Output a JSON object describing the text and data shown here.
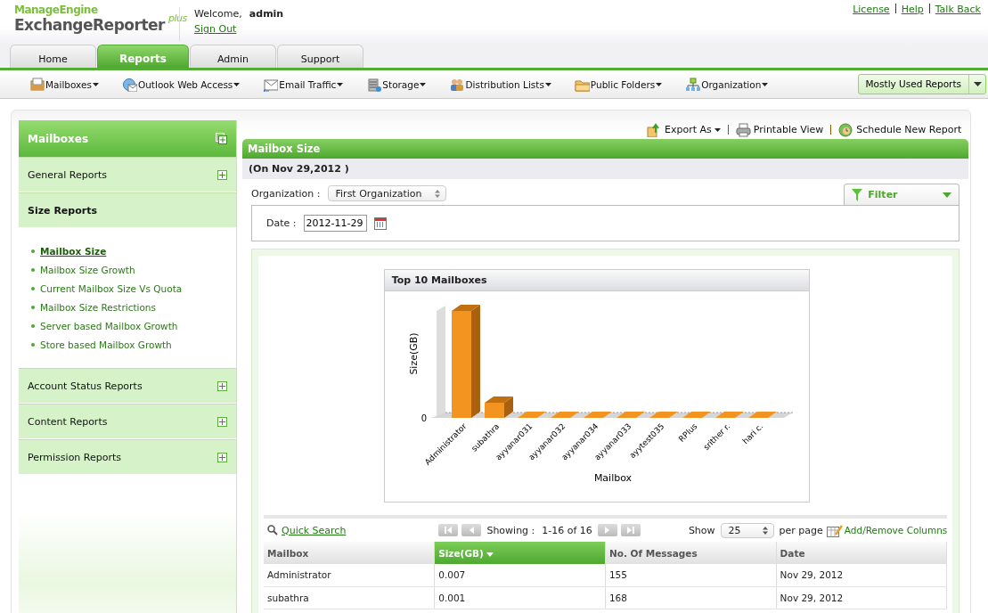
{
  "header": {
    "logo_top": "ManageEngine",
    "logo_main": "ExchangeReporter",
    "logo_suffix": "plus",
    "welcome": "Welcome,",
    "user": "admin",
    "sign_out": "Sign Out",
    "links": [
      "License",
      "Help",
      "Talk Back"
    ]
  },
  "tabs": [
    {
      "label": "Home",
      "selected": false
    },
    {
      "label": "Reports",
      "selected": true
    },
    {
      "label": "Admin",
      "selected": false
    },
    {
      "label": "Support",
      "selected": false
    }
  ],
  "menu": [
    {
      "label": "Mailboxes"
    },
    {
      "label": "Outlook Web Access"
    },
    {
      "label": "Email Traffic"
    },
    {
      "label": "Storage"
    },
    {
      "label": "Distribution Lists"
    },
    {
      "label": "Public Folders"
    },
    {
      "label": "Organization"
    }
  ],
  "quick_reports": {
    "label": "Mostly Used Reports"
  },
  "sidebar": {
    "title": "Mailboxes",
    "groups": [
      {
        "label": "General Reports",
        "expanded": false
      },
      {
        "label": "Size Reports",
        "expanded": true,
        "items": [
          {
            "label": "Mailbox Size",
            "selected": true
          },
          {
            "label": "Mailbox Size Growth",
            "selected": false
          },
          {
            "label": "Current Mailbox Size Vs Quota",
            "selected": false
          },
          {
            "label": "Mailbox Size Restrictions",
            "selected": false
          },
          {
            "label": "Server based Mailbox Growth",
            "selected": false
          },
          {
            "label": "Store based Mailbox Growth",
            "selected": false
          }
        ]
      },
      {
        "label": "Account Status Reports",
        "expanded": false
      },
      {
        "label": "Content Reports",
        "expanded": false
      },
      {
        "label": "Permission Reports",
        "expanded": false
      }
    ]
  },
  "actions": [
    {
      "label": "Export As",
      "caret": true
    },
    {
      "label": "Printable View",
      "caret": false
    },
    {
      "label": "Schedule New Report",
      "caret": false
    }
  ],
  "report": {
    "title": "Mailbox Size",
    "subtitle": "(On Nov 29,2012 )",
    "organization_label": "Organization :",
    "organization": "First Organization",
    "filter": "Filter",
    "date_label": "Date :",
    "date": "2012-11-29"
  },
  "chart": {
    "title": "Top 10 Mailboxes",
    "ylabel": "Size(GB)",
    "xlabel": "Mailbox",
    "ytick": "0",
    "categories": [
      "Administrator",
      "subathra",
      "ayyanar031",
      "ayyanar032",
      "ayyanar034",
      "ayyanar033",
      "ayytest035",
      "RPlus",
      "srither r.",
      "hari c."
    ]
  },
  "table": {
    "search": "Quick Search",
    "showing_label": "Showing :",
    "showing": "1-16 of 16",
    "show": "Show",
    "page_size": "25",
    "per_page": "per page",
    "columns_link": "Add/Remove Columns",
    "columns": [
      {
        "label": "Mailbox",
        "sorted": false
      },
      {
        "label": "Size(GB)",
        "sorted": true
      },
      {
        "label": "No. Of Messages",
        "sorted": false
      },
      {
        "label": "Date",
        "sorted": false
      }
    ],
    "rows": [
      [
        "Administrator",
        "0.007",
        "155",
        "Nov 29, 2012"
      ],
      [
        "subathra",
        "0.001",
        "168",
        "Nov 29, 2012"
      ]
    ]
  }
}
